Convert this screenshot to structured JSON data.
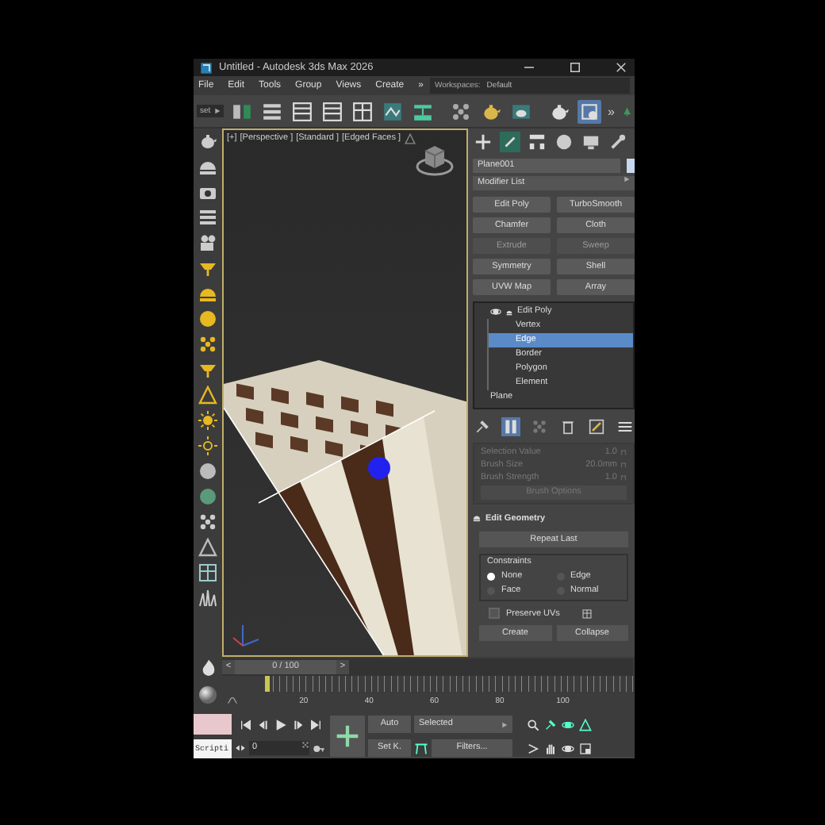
{
  "window": {
    "title": "Untitled - Autodesk 3ds Max 2026"
  },
  "menu": {
    "items": [
      "File",
      "Edit",
      "Tools",
      "Group",
      "Views",
      "Create"
    ],
    "overflow": "»",
    "workspaces_label": "Workspaces:",
    "workspace": "Default"
  },
  "toolbar": {
    "filter": "set",
    "overflow": "»",
    "tools": [
      {
        "on": false
      },
      {
        "on": false
      },
      {
        "on": false
      },
      {
        "on": false
      },
      {
        "on": false
      },
      {
        "on": false
      },
      {
        "on": false
      },
      {
        "on": false
      },
      {
        "on": false
      },
      {
        "on": false
      },
      {
        "on": false
      },
      {
        "on": true
      }
    ]
  },
  "viewport": {
    "labels": [
      "[+]",
      "[Perspective ]",
      "[Standard ]",
      "[Edged Faces ]"
    ]
  },
  "command_panel": {
    "tabs": [
      {
        "selected": false
      },
      {
        "selected": true
      },
      {
        "selected": false
      },
      {
        "selected": false
      },
      {
        "selected": false
      },
      {
        "selected": false
      }
    ],
    "object_name": "Plane001",
    "modifier_list": "Modifier List",
    "modifiers": [
      {
        "label": "Edit Poly",
        "disabled": false
      },
      {
        "label": "TurboSmooth",
        "disabled": false
      },
      {
        "label": "Chamfer",
        "disabled": false
      },
      {
        "label": "Cloth",
        "disabled": false
      },
      {
        "label": "Extrude",
        "disabled": true
      },
      {
        "label": "Sweep",
        "disabled": true
      },
      {
        "label": "Symmetry",
        "disabled": false
      },
      {
        "label": "Shell",
        "disabled": false
      },
      {
        "label": "UVW Map",
        "disabled": false
      },
      {
        "label": "Array",
        "disabled": false
      }
    ],
    "stack": [
      {
        "label": "Edit Poly",
        "expanded": true,
        "children": [
          {
            "label": "Vertex",
            "selected": false
          },
          {
            "label": "Edge",
            "selected": true
          },
          {
            "label": "Border",
            "selected": false
          },
          {
            "label": "Polygon",
            "selected": false
          },
          {
            "label": "Element",
            "selected": false
          }
        ]
      },
      {
        "label": "Plane"
      }
    ],
    "stack_tools": [
      {
        "on": false
      },
      {
        "on": true
      },
      {
        "on": false
      },
      {
        "on": false
      },
      {
        "on": false
      },
      {
        "on": false
      }
    ],
    "brush": [
      {
        "label": "Selection Value",
        "value": "1.0",
        "disabled": true
      },
      {
        "label": "Brush Size",
        "value": "20.0mm",
        "disabled": true
      },
      {
        "label": "Brush Strength",
        "value": "1.0",
        "disabled": true
      }
    ],
    "brush_options": {
      "label": "Brush Options",
      "disabled": true
    },
    "edit_geometry": {
      "title": "Edit Geometry",
      "expanded": true,
      "repeat_last": "Repeat Last",
      "constraints_label": "Constraints",
      "constraints": [
        {
          "label": "None",
          "selected": true
        },
        {
          "label": "Edge",
          "selected": false
        },
        {
          "label": "Face",
          "selected": false
        },
        {
          "label": "Normal",
          "selected": false
        }
      ],
      "preserve_uvs": {
        "label": "Preserve UVs",
        "checked": false
      },
      "buttons": [
        "Create",
        "Collapse"
      ]
    }
  },
  "timeline": {
    "prev": "<",
    "position": "0 / 100",
    "next": ">",
    "level": 0,
    "ticks": [
      "20",
      "40",
      "60",
      "80",
      "100"
    ]
  },
  "controls": {
    "script": "Scripti",
    "frame": "0",
    "auto": "Auto",
    "set_key": "Set K.",
    "key_filter": "Selected",
    "filters": "Filters..."
  }
}
